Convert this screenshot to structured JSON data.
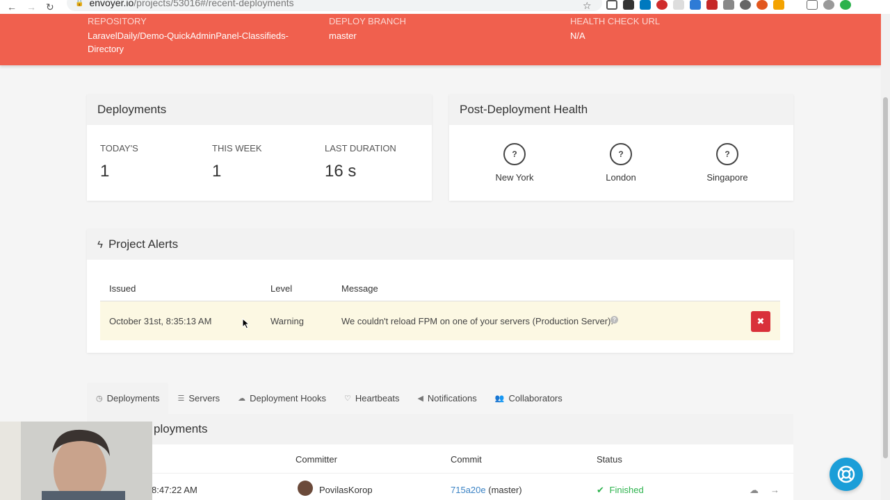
{
  "browser": {
    "host": "envoyer.io",
    "path": "/projects/53016#/recent-deployments"
  },
  "header": {
    "repository_label": "Repository",
    "repository_value": "LaravelDaily/Demo-QuickAdminPanel-Classifieds-Directory",
    "branch_label": "Deploy Branch",
    "branch_value": "master",
    "health_label": "Health Check URL",
    "health_value": "N/A"
  },
  "deployments_panel": {
    "title": "Deployments",
    "stats": [
      {
        "label": "Today's",
        "value": "1"
      },
      {
        "label": "This Week",
        "value": "1"
      },
      {
        "label": "Last Duration",
        "value": "16 s"
      }
    ]
  },
  "health_panel": {
    "title": "Post-Deployment Health",
    "locations": [
      {
        "name": "New York",
        "status": "?"
      },
      {
        "name": "London",
        "status": "?"
      },
      {
        "name": "Singapore",
        "status": "?"
      }
    ]
  },
  "alerts": {
    "title": "Project Alerts",
    "columns": [
      "Issued",
      "Level",
      "Message"
    ],
    "rows": [
      {
        "issued": "October 31st, 8:35:13 AM",
        "level": "Warning",
        "message": "We couldn't reload FPM on one of your servers (Production Server)."
      }
    ],
    "delete_label": "✖"
  },
  "tabs": [
    {
      "label": "Deployments",
      "icon": "clock-icon",
      "active": true
    },
    {
      "label": "Servers",
      "icon": "server-icon"
    },
    {
      "label": "Deployment Hooks",
      "icon": "cloud-icon"
    },
    {
      "label": "Heartbeats",
      "icon": "heart-icon"
    },
    {
      "label": "Notifications",
      "icon": "megaphone-icon"
    },
    {
      "label": "Collaborators",
      "icon": "users-icon"
    }
  ],
  "recent": {
    "title": "ployments",
    "columns": [
      "Committer",
      "Commit",
      "Status"
    ],
    "row": {
      "time": "8:47:22 AM",
      "committer": "PovilasKorop",
      "commit_hash": "715a20e",
      "commit_branch": "(master)",
      "status": "Finished"
    }
  },
  "colors": {
    "brand_red": "#f0604e",
    "danger": "#d9303a",
    "warning_bg": "#fcf8e3",
    "link": "#3a82c4",
    "success": "#2bb24c",
    "help_blue": "#1b9ed8"
  }
}
